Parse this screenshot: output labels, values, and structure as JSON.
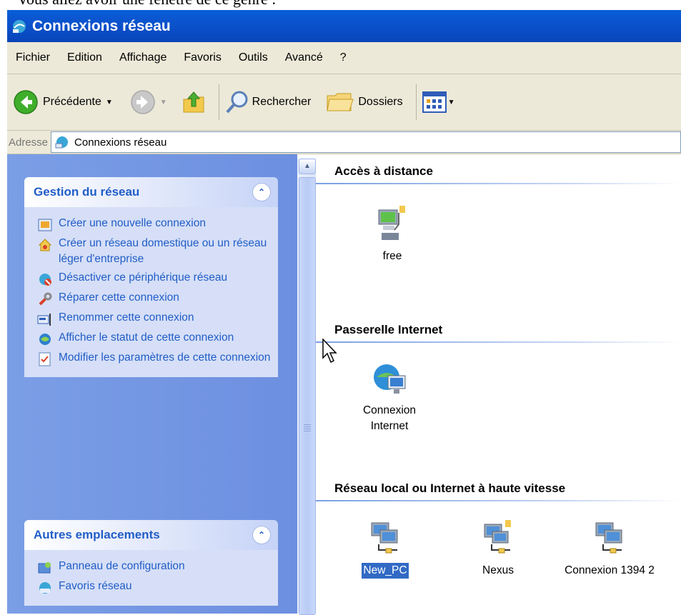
{
  "caption": "Vous allez avoir une fenêtre de ce genre :",
  "window": {
    "title": "Connexions réseau"
  },
  "menu": [
    "Fichier",
    "Edition",
    "Affichage",
    "Favoris",
    "Outils",
    "Avancé",
    "?"
  ],
  "toolbar": {
    "back_label": "Précédente",
    "search_label": "Rechercher",
    "folders_label": "Dossiers"
  },
  "address": {
    "label": "Adresse",
    "value": "Connexions réseau"
  },
  "panels": {
    "network": {
      "title": "Gestion du réseau",
      "tasks": [
        "Créer une nouvelle connexion",
        "Créer un réseau domestique ou un réseau léger d'entreprise",
        "Désactiver ce périphérique réseau",
        "Réparer cette connexion",
        "Renommer cette connexion",
        "Afficher le statut de cette connexion",
        "Modifier les paramètres de cette connexion"
      ]
    },
    "other": {
      "title": "Autres emplacements",
      "items": [
        "Panneau de configuration",
        "Favoris réseau"
      ]
    }
  },
  "groups": {
    "remote": {
      "title": "Accès à distance",
      "items": [
        "free"
      ]
    },
    "gateway": {
      "title": "Passerelle Internet",
      "items": [
        "Connexion Internet"
      ]
    },
    "lan": {
      "title": "Réseau local ou Internet à haute vitesse",
      "items": [
        "New_PC",
        "Nexus",
        "Connexion 1394 2"
      ]
    }
  },
  "colors": {
    "titlebar": "#0a55d0",
    "task_link": "#215dc6",
    "selection": "#316ac5"
  }
}
